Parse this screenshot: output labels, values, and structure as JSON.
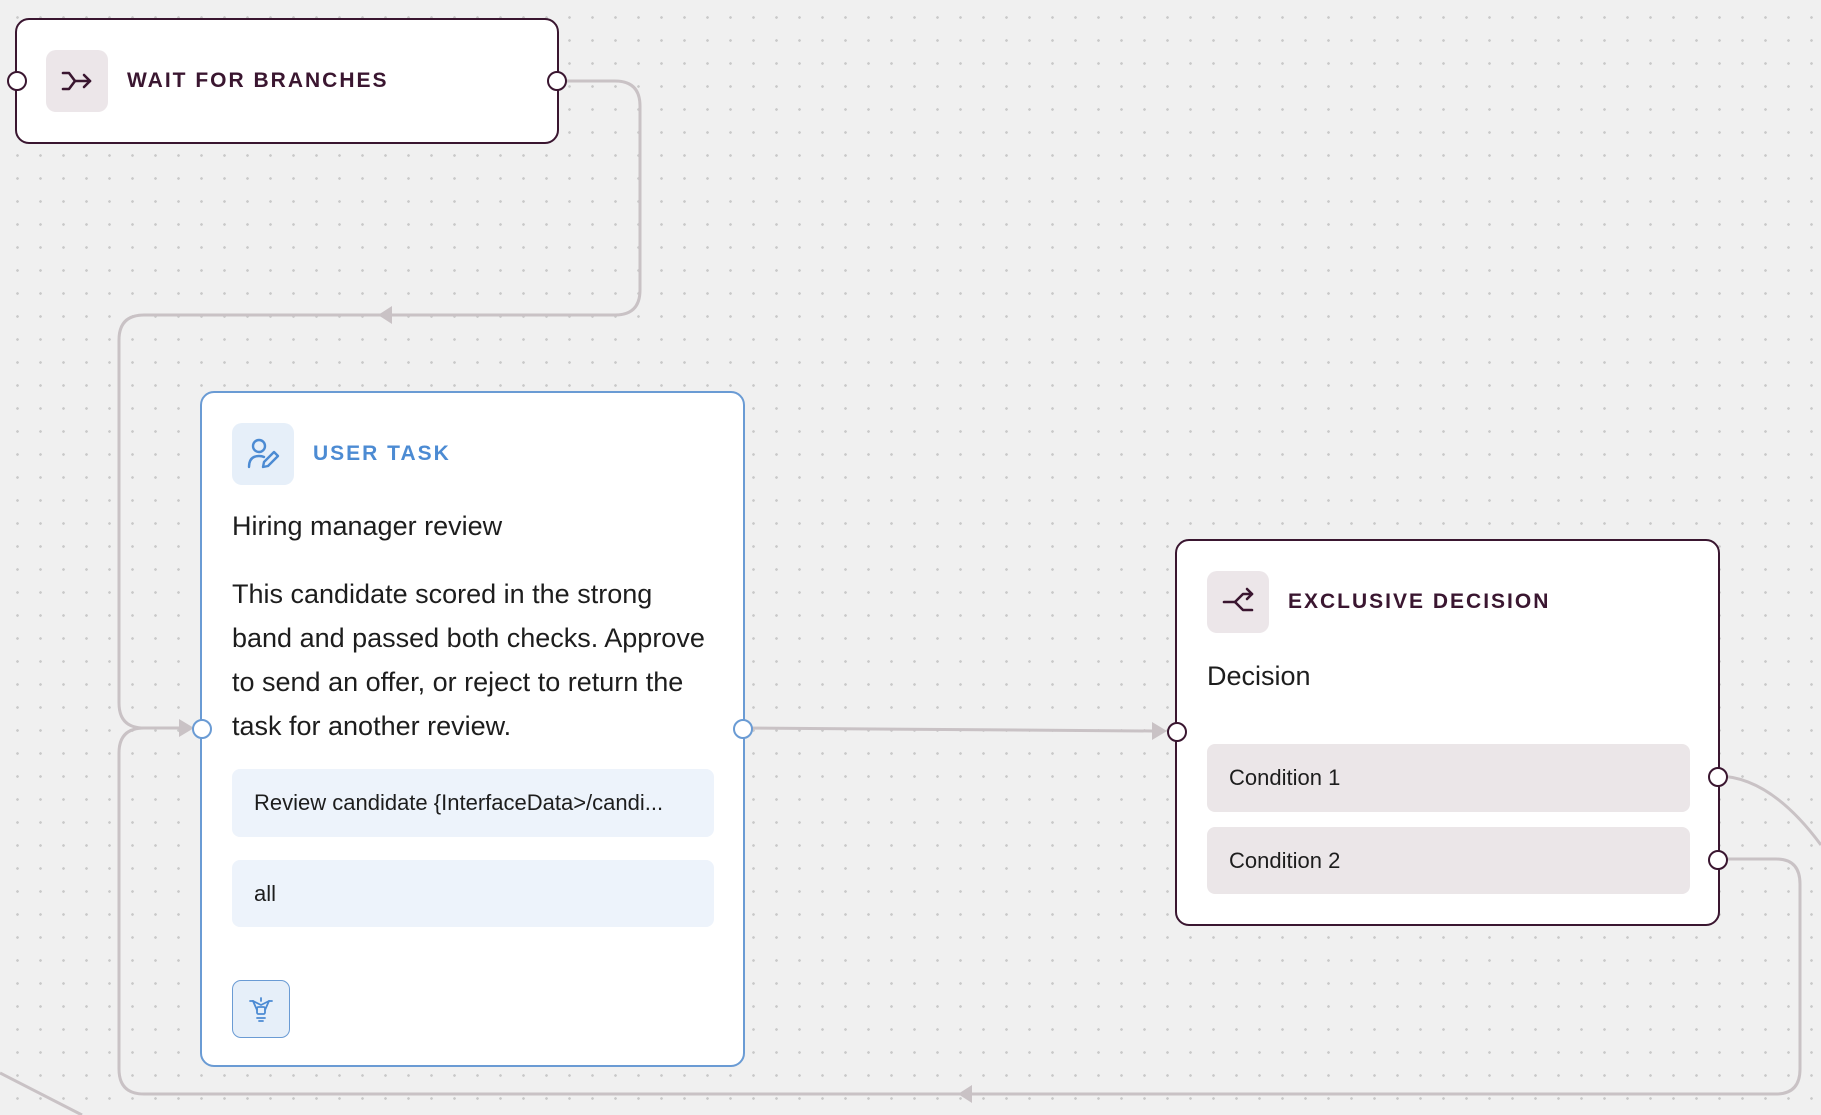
{
  "colors": {
    "canvas_background": "#f0f0f0",
    "grid_dot": "#c9c9c9",
    "connector": "#c9c2c5",
    "dark_node_border": "#3a1630",
    "blue_node_border": "#6a9bd4",
    "blue_accent": "#4c8bd3",
    "blue_field": "#edf3fb",
    "grey_field": "#ebe6e8"
  },
  "nodes": {
    "wait_for_branches": {
      "title": "WAIT FOR BRANCHES",
      "icon": "merge-arrow-icon"
    },
    "user_task": {
      "title": "USER TASK",
      "icon": "user-edit-icon",
      "name": "Hiring manager review",
      "description": "This candidate scored in the strong band and passed both checks. Approve to send an offer, or reject to return the task for another review.",
      "subject_field": "Review candidate {InterfaceData>/candi...",
      "recipients_field": "all",
      "action_icon": "flow-settings-icon"
    },
    "exclusive_decision": {
      "title": "EXCLUSIVE DECISION",
      "icon": "split-arrow-icon",
      "name": "Decision",
      "conditions": [
        "Condition 1",
        "Condition 2"
      ]
    }
  }
}
